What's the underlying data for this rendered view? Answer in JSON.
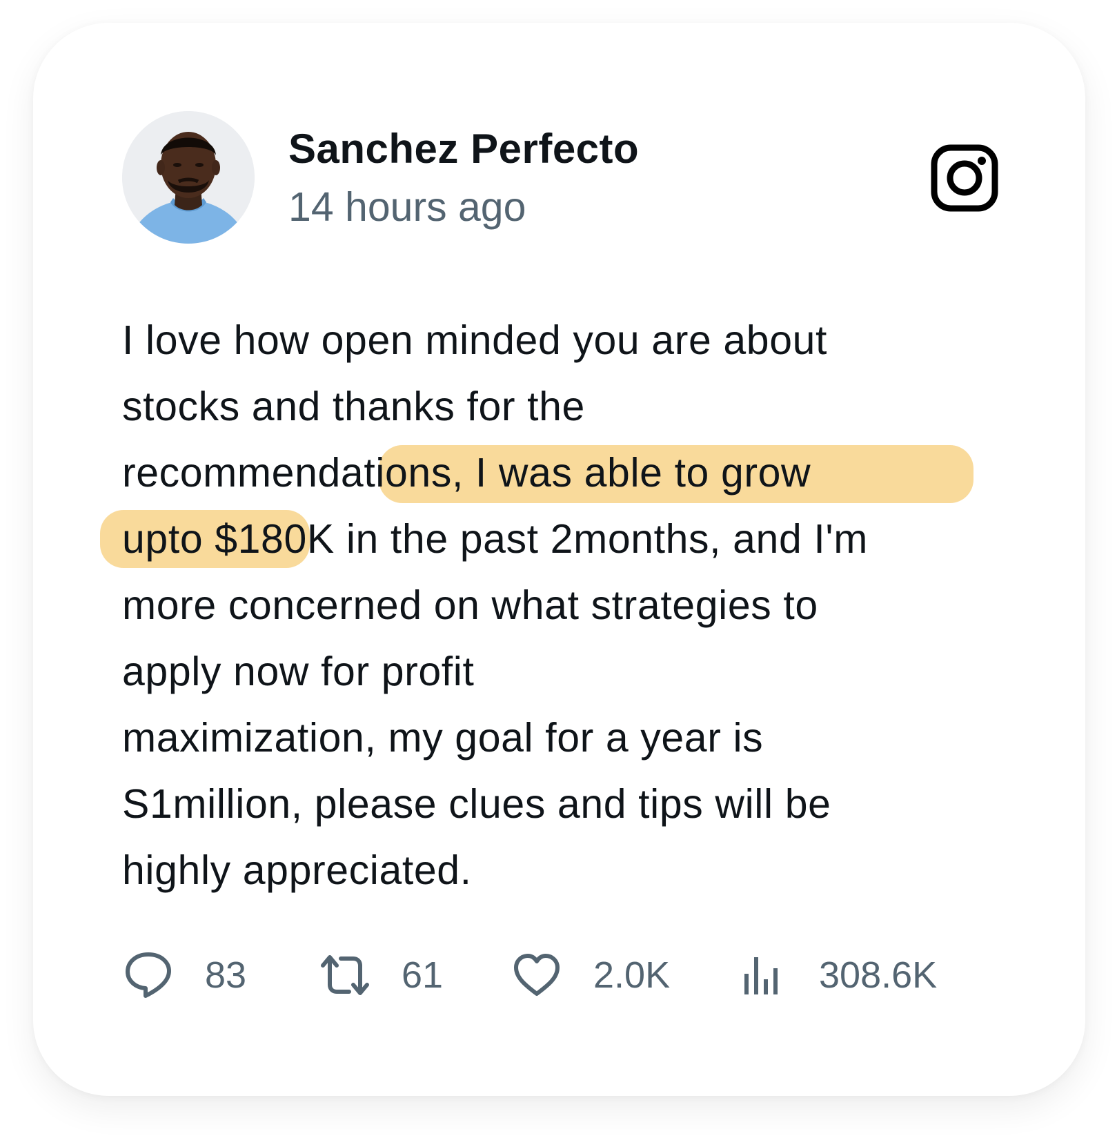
{
  "post": {
    "author_name": "Sanchez Perfecto",
    "timestamp": "14 hours ago",
    "platform_icon": "instagram-icon",
    "avatar_alt": "avatar",
    "body_lines": [
      {
        "pre": "I love how open minded you are about",
        "mid": "",
        "post": ""
      },
      {
        "pre": "stocks and thanks for the",
        "mid": "",
        "post": ""
      },
      {
        "pre": "recommendations, I was able to grow",
        "mid": "",
        "post": ""
      },
      {
        "pre": "upto $180K in the past 2months, and I'm",
        "mid": "",
        "post": ""
      },
      {
        "pre": "more concerned on what strategies to",
        "mid": "",
        "post": ""
      },
      {
        "pre": "apply now for profit",
        "mid": "",
        "post": ""
      },
      {
        "pre": "maximization, my goal for a year is",
        "mid": "",
        "post": ""
      },
      {
        "pre": "S1million, please clues and tips will be",
        "mid": "",
        "post": ""
      },
      {
        "pre": "highly appreciated.",
        "mid": "",
        "post": ""
      }
    ],
    "highlight_color": "#f8d793"
  },
  "actions": {
    "replies": {
      "icon": "comment-icon",
      "count": "83"
    },
    "reposts": {
      "icon": "repost-icon",
      "count": "61"
    },
    "likes": {
      "icon": "heart-icon",
      "count": "2.0K"
    },
    "views": {
      "icon": "views-chart-icon",
      "count": "308.6K"
    }
  },
  "colors": {
    "text_primary": "#0f1419",
    "text_secondary": "#536471",
    "highlight": "#f8d793"
  }
}
